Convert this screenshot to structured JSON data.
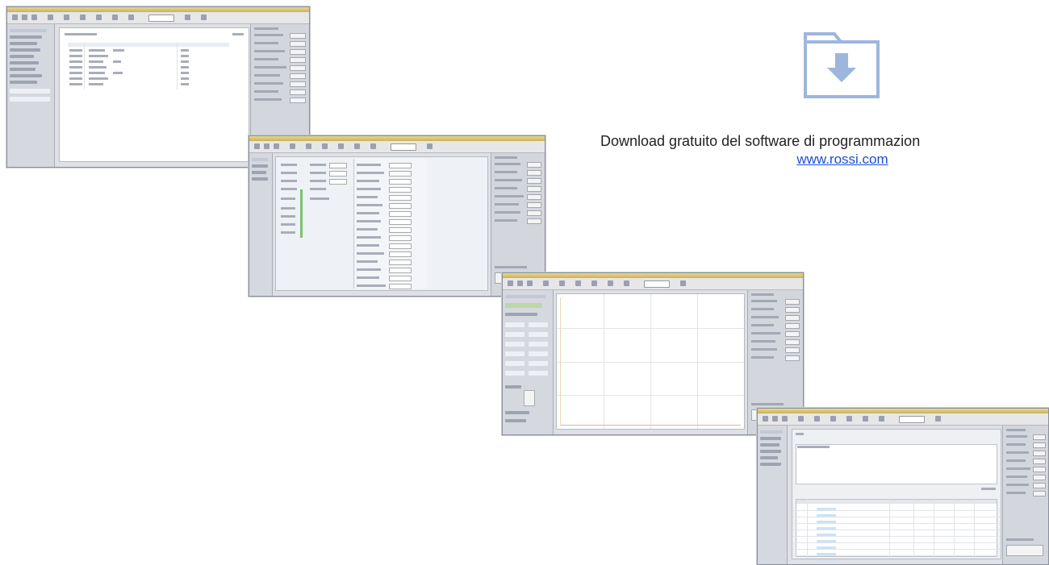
{
  "download": {
    "icon": "folder-download-icon",
    "text": "Download gratuito del software di programmazion",
    "link": "www.rossi.com"
  },
  "colors": {
    "folder_icon": "#9db6dc",
    "link": "#1a4fd6",
    "window_bg": "#dfe0e6"
  }
}
